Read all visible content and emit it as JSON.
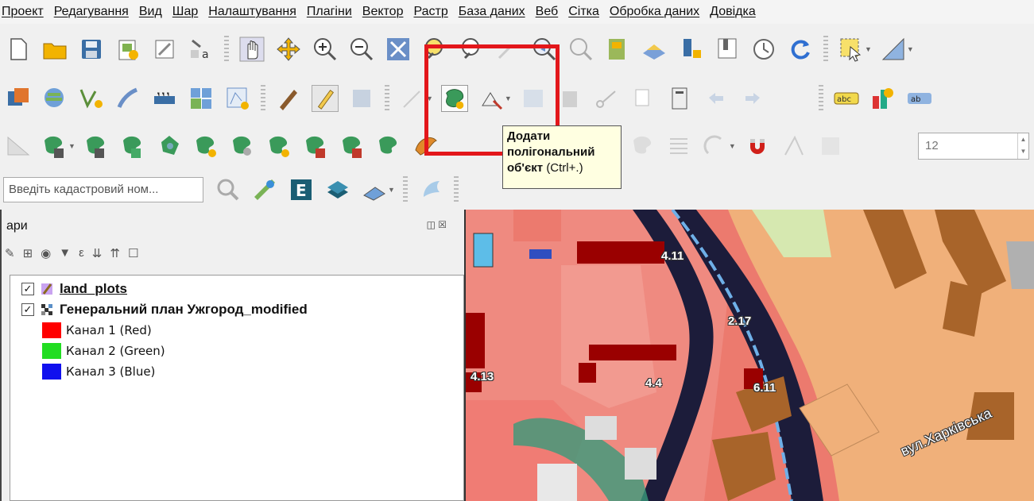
{
  "menu": [
    "Проект",
    "Редагування",
    "Вид",
    "Шар",
    "Налаштування",
    "Плагіни",
    "Вектор",
    "Растр",
    "База даних",
    "Веб",
    "Сітка",
    "Обробка даних",
    "Довідка"
  ],
  "search": {
    "placeholder": "Введіть кадастровий ном..."
  },
  "tooltip": {
    "title_bold": "Додати полігональний об'єкт",
    "shortcut": "(Ctrl+.)"
  },
  "spin": {
    "value": "12"
  },
  "panel": {
    "title": "ари"
  },
  "layers": [
    {
      "name": "land_plots",
      "checked": "✓"
    },
    {
      "name": "Генеральний план Ужгород_modified",
      "checked": "✓"
    }
  ],
  "bands": [
    {
      "label": "Канал 1 (Red)",
      "color": "#ff0000"
    },
    {
      "label": "Канал 2 (Green)",
      "color": "#22dd22"
    },
    {
      "label": "Канал 3 (Blue)",
      "color": "#1010ee"
    }
  ],
  "map_labels": [
    "4.11",
    "2.17",
    "4.13",
    "4.4",
    "6.11"
  ],
  "street": "вул.Харківська",
  "colors": {
    "highlight": "#e3171b",
    "tooltip_bg": "#ffffe1"
  }
}
